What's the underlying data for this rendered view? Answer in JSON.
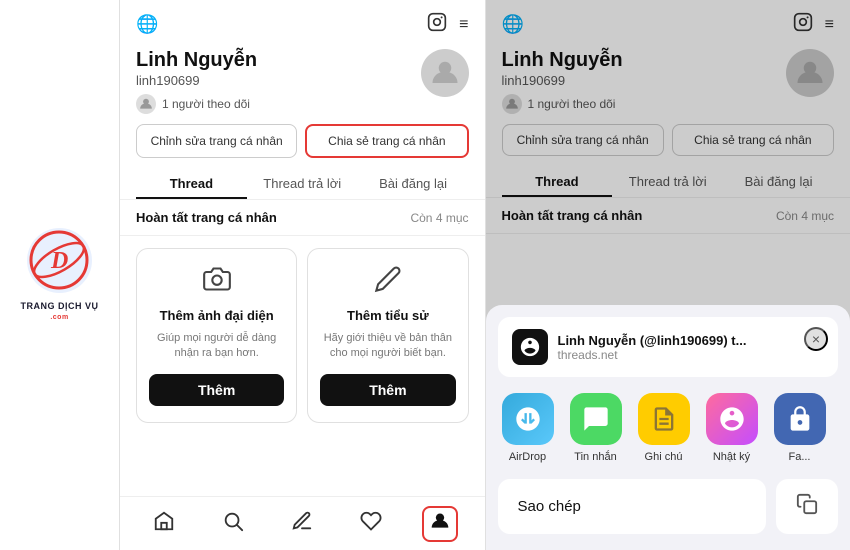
{
  "logo": {
    "letter": "D",
    "line1": "TRANG DỊCH VỤ",
    "com": ".com"
  },
  "left_screen": {
    "top_icons": {
      "globe": "🌐",
      "instagram": "📷",
      "menu": "≡"
    },
    "profile": {
      "name": "Linh Nguyễn",
      "username": "linh190699",
      "followers": "1 người theo dõi"
    },
    "buttons": {
      "edit": "Chỉnh sửa trang cá nhân",
      "share": "Chia sẻ trang cá nhân"
    },
    "tabs": [
      {
        "label": "Thread",
        "active": true
      },
      {
        "label": "Thread trả lời",
        "active": false
      },
      {
        "label": "Bài đăng lại",
        "active": false
      }
    ],
    "banner": {
      "text": "Hoàn tất trang cá nhân",
      "count": "Còn 4 mục"
    },
    "cards": [
      {
        "icon": "📷",
        "title": "Thêm ảnh đại diện",
        "desc": "Giúp mọi người dễ dàng nhận ra bạn hơn.",
        "btn": "Thêm"
      },
      {
        "icon": "✏️",
        "title": "Thêm tiểu sử",
        "desc": "Hãy giới thiệu về bản thân cho mọi người biết bạn.",
        "btn": "Thêm"
      }
    ],
    "nav": [
      {
        "icon": "⌂",
        "label": "home",
        "active": false
      },
      {
        "icon": "🔍",
        "label": "search",
        "active": false
      },
      {
        "icon": "↺",
        "label": "refresh",
        "active": false
      },
      {
        "icon": "♡",
        "label": "heart",
        "active": false
      },
      {
        "icon": "👤",
        "label": "profile",
        "active": true
      }
    ]
  },
  "right_screen": {
    "top_icons": {
      "globe": "🌐",
      "instagram": "📷",
      "menu": "≡"
    },
    "profile": {
      "name": "Linh Nguyễn",
      "username": "linh190699",
      "followers": "1 người theo dõi"
    },
    "buttons": {
      "edit": "Chỉnh sửa trang cá nhân",
      "share": "Chia sẻ trang cá nhân"
    },
    "tabs": [
      {
        "label": "Thread",
        "active": true
      },
      {
        "label": "Thread trả lời",
        "active": false
      },
      {
        "label": "Bài đăng lại",
        "active": false
      }
    ],
    "banner": {
      "text": "Hoàn tất trang cá nhân",
      "count": "Còn 4 mục"
    },
    "share_sheet": {
      "preview_title": "Linh Nguyễn (@linh190699) t...",
      "preview_url": "threads.net",
      "close_btn": "×",
      "apps": [
        {
          "label": "AirDrop",
          "type": "airdrop",
          "icon": "📡"
        },
        {
          "label": "Tin nhắn",
          "type": "message",
          "icon": "💬"
        },
        {
          "label": "Ghi chú",
          "type": "notes",
          "icon": "📝"
        },
        {
          "label": "Nhật ký",
          "type": "diary",
          "icon": "🦋"
        },
        {
          "label": "Fa...",
          "type": "more",
          "icon": "📘"
        }
      ],
      "copy_btn": "Sao chép",
      "copy_icon": "⧉"
    }
  }
}
